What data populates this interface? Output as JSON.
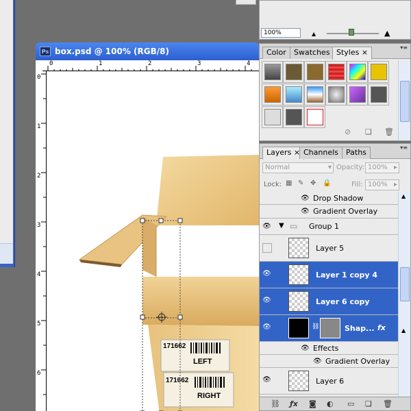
{
  "document": {
    "title": "box.psd @ 100% (RGB/8)",
    "ps_icon": "Ps",
    "ruler_top": [
      "0",
      "1",
      "2",
      "3",
      "4"
    ],
    "ruler_left": [
      "0",
      "1",
      "2",
      "3",
      "4",
      "5",
      "6"
    ],
    "label_left": "LEFT",
    "label_right": "RIGHT",
    "barcode_left": "171662",
    "barcode_right": "171662"
  },
  "navigator": {
    "zoom_value": "100%"
  },
  "styles_panel": {
    "tabs": [
      "Color",
      "Swatches",
      "Styles"
    ],
    "active_tab": "Styles"
  },
  "layers_panel": {
    "tabs": [
      "Layers",
      "Channels",
      "Paths"
    ],
    "blend_mode": "Normal",
    "opacity_label": "Opacity:",
    "opacity_value": "100%",
    "lock_label": "Lock:",
    "fill_label": "Fill:",
    "fill_value": "100%",
    "rows": {
      "drop_shadow": "Drop Shadow",
      "gradient_overlay_top": "Gradient Overlay",
      "group": "Group 1",
      "layer5": "Layer 5",
      "layer1c4": "Layer 1 copy 4",
      "layer6c": "Layer 6 copy",
      "shape": "Shap...",
      "effects": "Effects",
      "gradient_overlay_bottom": "Gradient Overlay",
      "layer6": "Layer 6"
    },
    "fx": "fx"
  },
  "colors": {
    "accent": "#3264c8",
    "titlebar": "#2d5fd0",
    "panel_bg": "#ebebeb"
  }
}
